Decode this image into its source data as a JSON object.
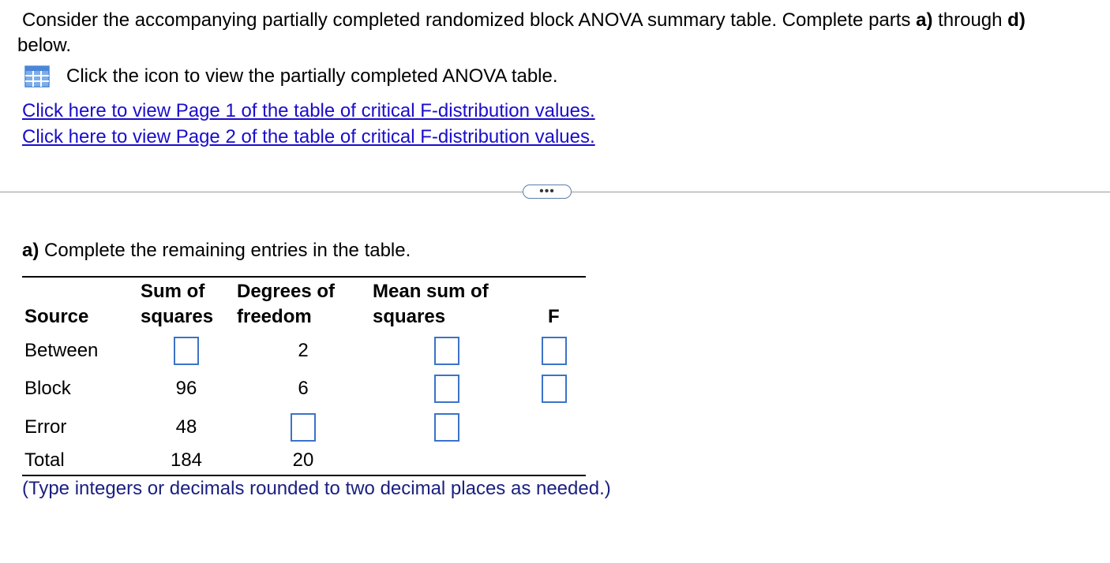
{
  "question": {
    "part1": "Consider the accompanying partially completed randomized block ANOVA summary table. Complete parts ",
    "bold1": "a)",
    "part2": " through ",
    "bold2": "d)",
    "part3": " below."
  },
  "icon_text": "Click the icon to view the partially completed ANOVA table.",
  "links": {
    "page1": "Click here to view Page 1 of the table of critical F-distribution values.",
    "page2": "Click here to view Page 2 of the table of critical F-distribution values."
  },
  "more_button": "•••",
  "part_a": {
    "label": "a)",
    "text": " Complete the remaining entries in the table."
  },
  "table": {
    "headers": {
      "source": "Source",
      "ss_line1": "Sum of",
      "ss_line2": "squares",
      "df_line1": "Degrees of",
      "df_line2": "freedom",
      "ms_line1": "Mean sum of",
      "ms_line2": "squares",
      "f": "F"
    },
    "rows": [
      {
        "source": "Between",
        "ss": "",
        "df": "2",
        "ms": "",
        "f": ""
      },
      {
        "source": "Block",
        "ss": "96",
        "df": "6",
        "ms": "",
        "f": ""
      },
      {
        "source": "Error",
        "ss": "48",
        "df": "",
        "ms": ""
      },
      {
        "source": "Total",
        "ss": "184",
        "df": "20"
      }
    ]
  },
  "hint": "(Type integers or decimals rounded to two decimal places as needed.)",
  "colors": {
    "link": "#1a0dcc",
    "input_border": "#3b73c9",
    "hint": "#1b2080",
    "icon": "#4a86d8"
  },
  "icons": {
    "table_icon": "table-grid-icon",
    "more": "ellipsis-icon"
  }
}
